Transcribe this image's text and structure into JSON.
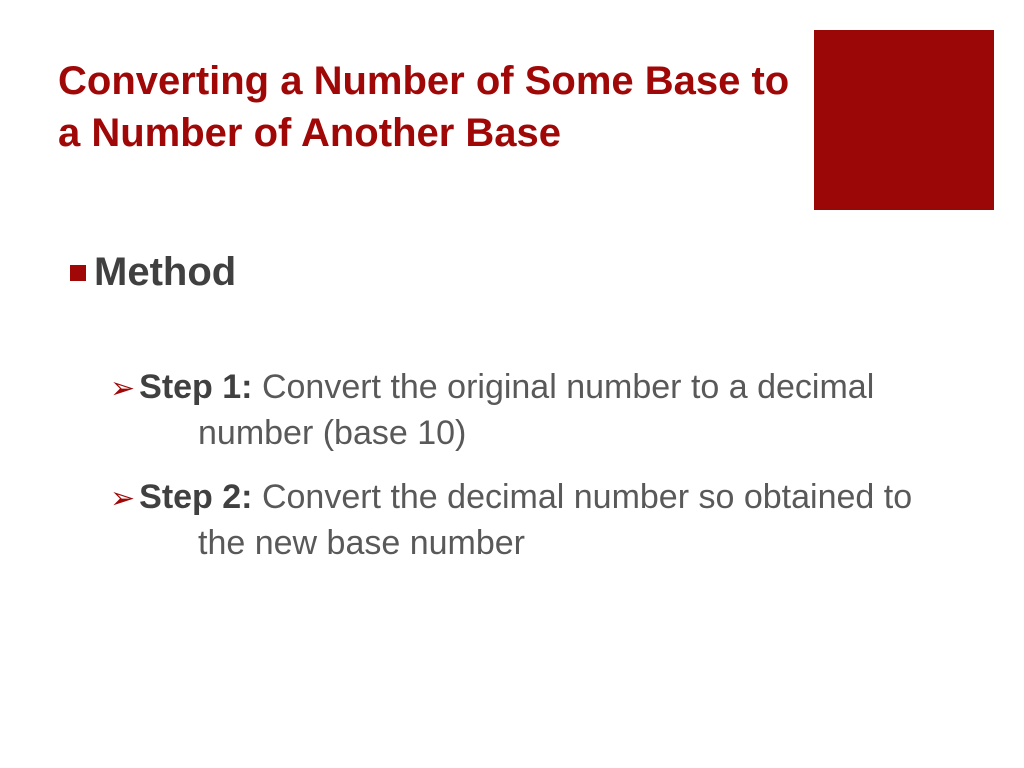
{
  "slide": {
    "title": "Converting a Number of Some Base to a Number of Another Base",
    "methodLabel": "Method",
    "steps": [
      {
        "label": "Step 1:",
        "body": " Convert the original number to a decimal number (base 10)"
      },
      {
        "label": "Step 2:",
        "body": " Convert the decimal number so obtained to the new base number"
      }
    ]
  }
}
